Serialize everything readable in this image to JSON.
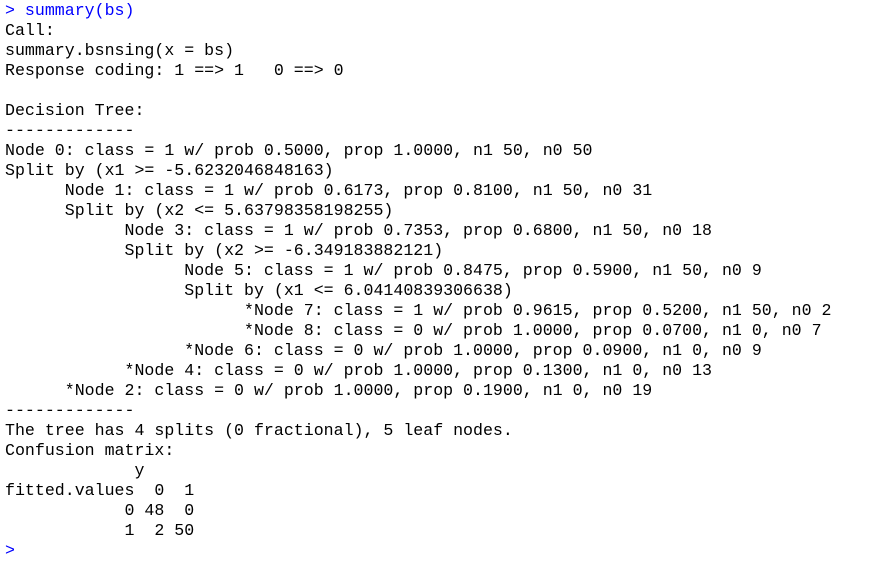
{
  "colors": {
    "input": "#0000ff",
    "output": "#000000",
    "background": "#ffffff"
  },
  "console": {
    "lines": [
      {
        "type": "input",
        "text": "> summary(bs)"
      },
      {
        "type": "output",
        "text": "Call:"
      },
      {
        "type": "output",
        "text": "summary.bsnsing(x = bs)"
      },
      {
        "type": "output",
        "text": "Response coding: 1 ==> 1   0 ==> 0"
      },
      {
        "type": "output",
        "text": ""
      },
      {
        "type": "output",
        "text": "Decision Tree:"
      },
      {
        "type": "output",
        "text": "-------------"
      },
      {
        "type": "output",
        "text": "Node 0: class = 1 w/ prob 0.5000, prop 1.0000, n1 50, n0 50"
      },
      {
        "type": "output",
        "text": "Split by (x1 >= -5.6232046848163)"
      },
      {
        "type": "output",
        "text": "      Node 1: class = 1 w/ prob 0.6173, prop 0.8100, n1 50, n0 31"
      },
      {
        "type": "output",
        "text": "      Split by (x2 <= 5.63798358198255)"
      },
      {
        "type": "output",
        "text": "            Node 3: class = 1 w/ prob 0.7353, prop 0.6800, n1 50, n0 18"
      },
      {
        "type": "output",
        "text": "            Split by (x2 >= -6.349183882121)"
      },
      {
        "type": "output",
        "text": "                  Node 5: class = 1 w/ prob 0.8475, prop 0.5900, n1 50, n0 9"
      },
      {
        "type": "output",
        "text": "                  Split by (x1 <= 6.04140839306638)"
      },
      {
        "type": "output",
        "text": "                        *Node 7: class = 1 w/ prob 0.9615, prop 0.5200, n1 50, n0 2"
      },
      {
        "type": "output",
        "text": "                        *Node 8: class = 0 w/ prob 1.0000, prop 0.0700, n1 0, n0 7"
      },
      {
        "type": "output",
        "text": "                  *Node 6: class = 0 w/ prob 1.0000, prop 0.0900, n1 0, n0 9"
      },
      {
        "type": "output",
        "text": "            *Node 4: class = 0 w/ prob 1.0000, prop 0.1300, n1 0, n0 13"
      },
      {
        "type": "output",
        "text": "      *Node 2: class = 0 w/ prob 1.0000, prop 0.1900, n1 0, n0 19"
      },
      {
        "type": "output",
        "text": "-------------"
      },
      {
        "type": "output",
        "text": "The tree has 4 splits (0 fractional), 5 leaf nodes."
      },
      {
        "type": "output",
        "text": "Confusion matrix:"
      },
      {
        "type": "output",
        "text": "             y"
      },
      {
        "type": "output",
        "text": "fitted.values  0  1"
      },
      {
        "type": "output",
        "text": "            0 48  0"
      },
      {
        "type": "output",
        "text": "            1  2 50"
      },
      {
        "type": "input",
        "text": ">"
      }
    ]
  }
}
